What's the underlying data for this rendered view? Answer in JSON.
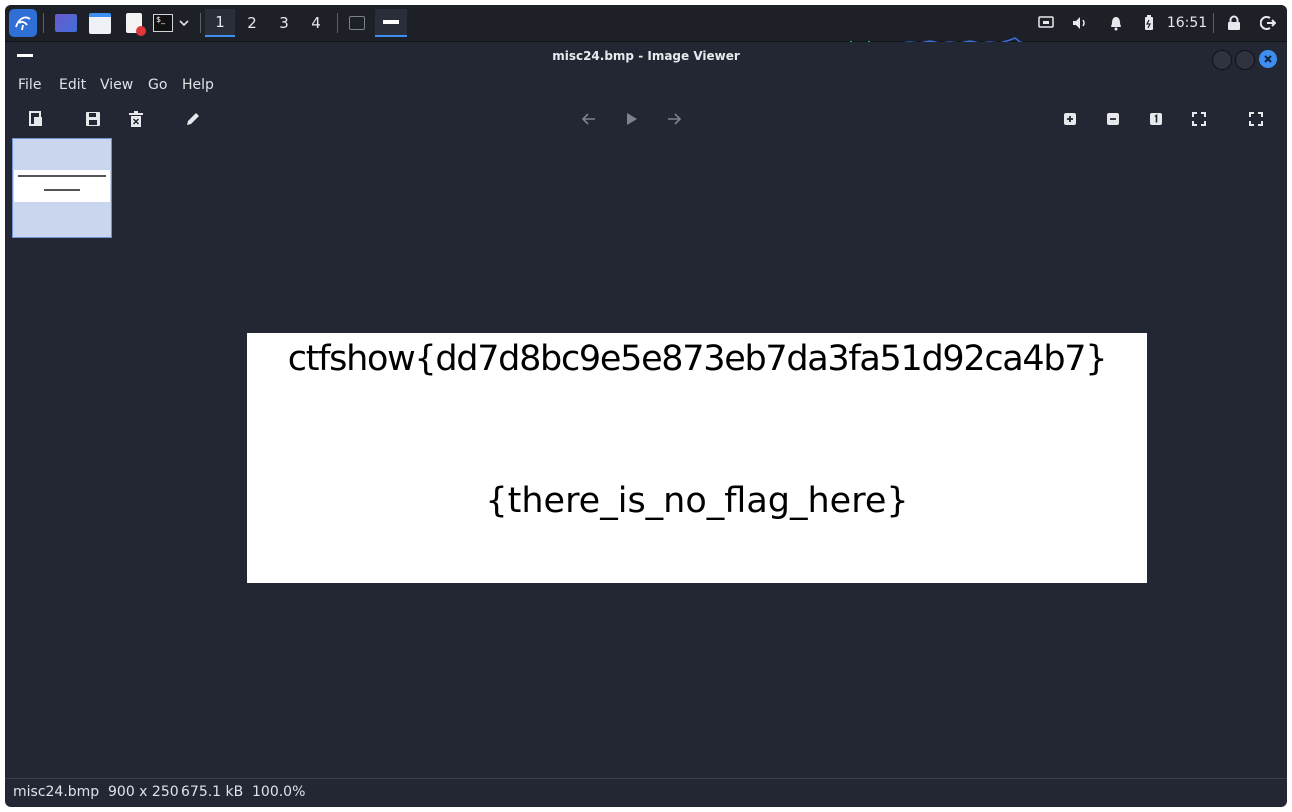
{
  "panel": {
    "workspaces": [
      "1",
      "2",
      "3",
      "4"
    ],
    "active_workspace_index": 0,
    "clock": "16:51",
    "icons": [
      "kali-menu-icon",
      "desktop-icon",
      "file-manager-icon",
      "text-editor-icon",
      "terminal-icon",
      "chevron-down-icon",
      "network-icon",
      "volume-icon",
      "notification-bell-icon",
      "battery-icon",
      "lock-icon",
      "logout-icon"
    ]
  },
  "window": {
    "title": "misc24.bmp - Image Viewer"
  },
  "menu": {
    "file": "File",
    "edit": "Edit",
    "view": "View",
    "go": "Go",
    "help": "Help"
  },
  "toolbar": {
    "icons": [
      "open-icon",
      "save-icon",
      "delete-icon",
      "edit-icon",
      "back-arrow-icon",
      "play-icon",
      "forward-arrow-icon",
      "zoom-in-icon",
      "zoom-out-icon",
      "zoom-100-icon",
      "zoom-fit-icon",
      "fullscreen-icon"
    ]
  },
  "image": {
    "line1": "ctfshow{dd7d8bc9e5e873eb7da3fa51d92ca4b7}",
    "line2": "{there_is_no_flag_here}"
  },
  "status": {
    "filename": "misc24.bmp",
    "dimensions": "900 x 250",
    "size": "675.1 kB",
    "zoom": "100.0%"
  },
  "colors": {
    "panel_bg": "#1d2027",
    "window_bg": "#232733",
    "accent": "#3d8ef0",
    "close_button": "#3d8ef0"
  }
}
